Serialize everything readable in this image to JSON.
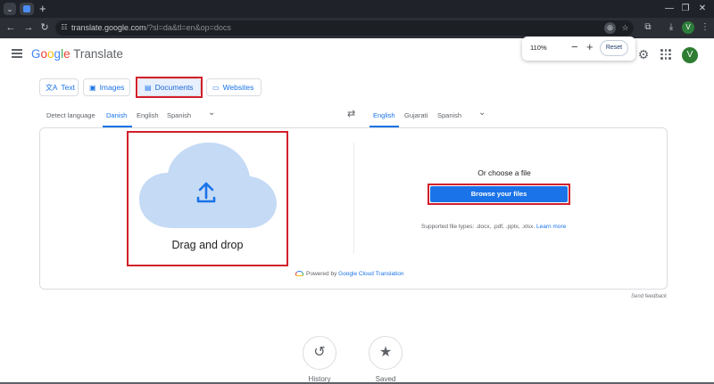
{
  "browser": {
    "url_host": "translate.google.com",
    "url_path": "/?sl=da&tl=en&op=docs",
    "profile_initial": "V"
  },
  "zoom_popup": {
    "level": "110%",
    "minus_label": "−",
    "plus_label": "+",
    "reset_label": "Reset"
  },
  "header": {
    "logo_letters": [
      "G",
      "o",
      "o",
      "g",
      "l",
      "e"
    ],
    "product": "Translate",
    "avatar_initial": "V"
  },
  "modes": [
    {
      "label": "Text",
      "icon": "translate-icon",
      "active": false
    },
    {
      "label": "Images",
      "icon": "image-icon",
      "active": false
    },
    {
      "label": "Documents",
      "icon": "document-icon",
      "active": true
    },
    {
      "label": "Websites",
      "icon": "website-icon",
      "active": false
    }
  ],
  "source_languages": [
    "Detect language",
    "Danish",
    "English",
    "Spanish"
  ],
  "source_selected": "Danish",
  "target_languages": [
    "English",
    "Gujarati",
    "Spanish"
  ],
  "target_selected": "English",
  "dropzone": {
    "label": "Drag and drop"
  },
  "file_picker": {
    "title": "Or choose a file",
    "browse_label": "Browse your files",
    "supported_text": "Supported file types: .docx, .pdf, .pptx, .xlsx.",
    "learn_more": "Learn more"
  },
  "powered_by": {
    "prefix": "Powered by",
    "service": "Google Cloud Translation"
  },
  "send_feedback": "Send feedback",
  "bottom_actions": [
    {
      "label": "History",
      "icon": "history-icon"
    },
    {
      "label": "Saved",
      "icon": "star-icon"
    }
  ],
  "colors": {
    "accent": "#1a73e8",
    "highlight_box": "#d21f2b",
    "cloud": "#c4daf5"
  }
}
